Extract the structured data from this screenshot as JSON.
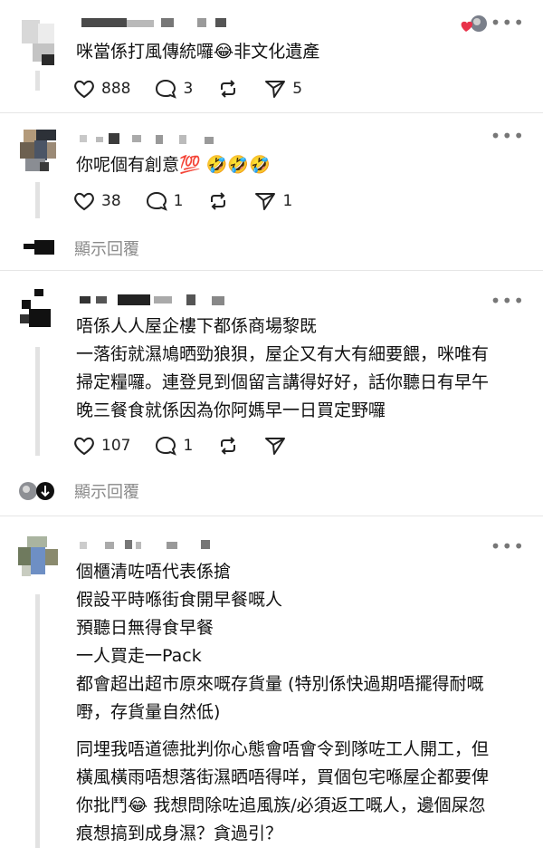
{
  "posts": [
    {
      "text": [
        "咪當係打風傳統囉😂非文化遺產"
      ],
      "likes": "888",
      "comments": "3",
      "reposts": "",
      "shares": "5"
    },
    {
      "text": [
        "你呢個有創意💯 🤣🤣🤣"
      ],
      "likes": "38",
      "comments": "1",
      "reposts": "",
      "shares": "1",
      "show_replies": "顯示回覆"
    },
    {
      "text": [
        "唔係人人屋企樓下都係商場黎既",
        "一落街就濕鳩晒勁狼狽，屋企又有大有細要餵，咪唯有",
        "掃定糧囉。連登見到個留言講得好好，話你聽日有早午",
        "晚三餐食就係因為你阿媽早一日買定野囉"
      ],
      "likes": "107",
      "comments": "1",
      "reposts": "",
      "shares": "",
      "show_replies": "顯示回覆"
    },
    {
      "text": [
        "個櫃清咗唔代表係搶",
        "假設平時喺街食開早餐嘅人",
        "預聽日無得食早餐",
        "一人買走一Pack",
        "都會超出超市原來嘅存貨量 (特別係快過期唔擺得耐嘅",
        "嘢，存貨量自然低)",
        "",
        "同埋我唔道德批判你心態會唔會令到隊咗工人開工，但",
        "橫風橫雨唔想落街濕晒唔得咩，買個包宅喺屋企都要俾",
        "你批鬥😂 我想問除咗追風族/必須返工嘅人，邊個屎忽",
        "痕想搞到成身濕？貪過引？"
      ]
    }
  ],
  "colors": {
    "accent": "#e8324a",
    "text": "#111111",
    "muted": "#8a8a8a"
  }
}
